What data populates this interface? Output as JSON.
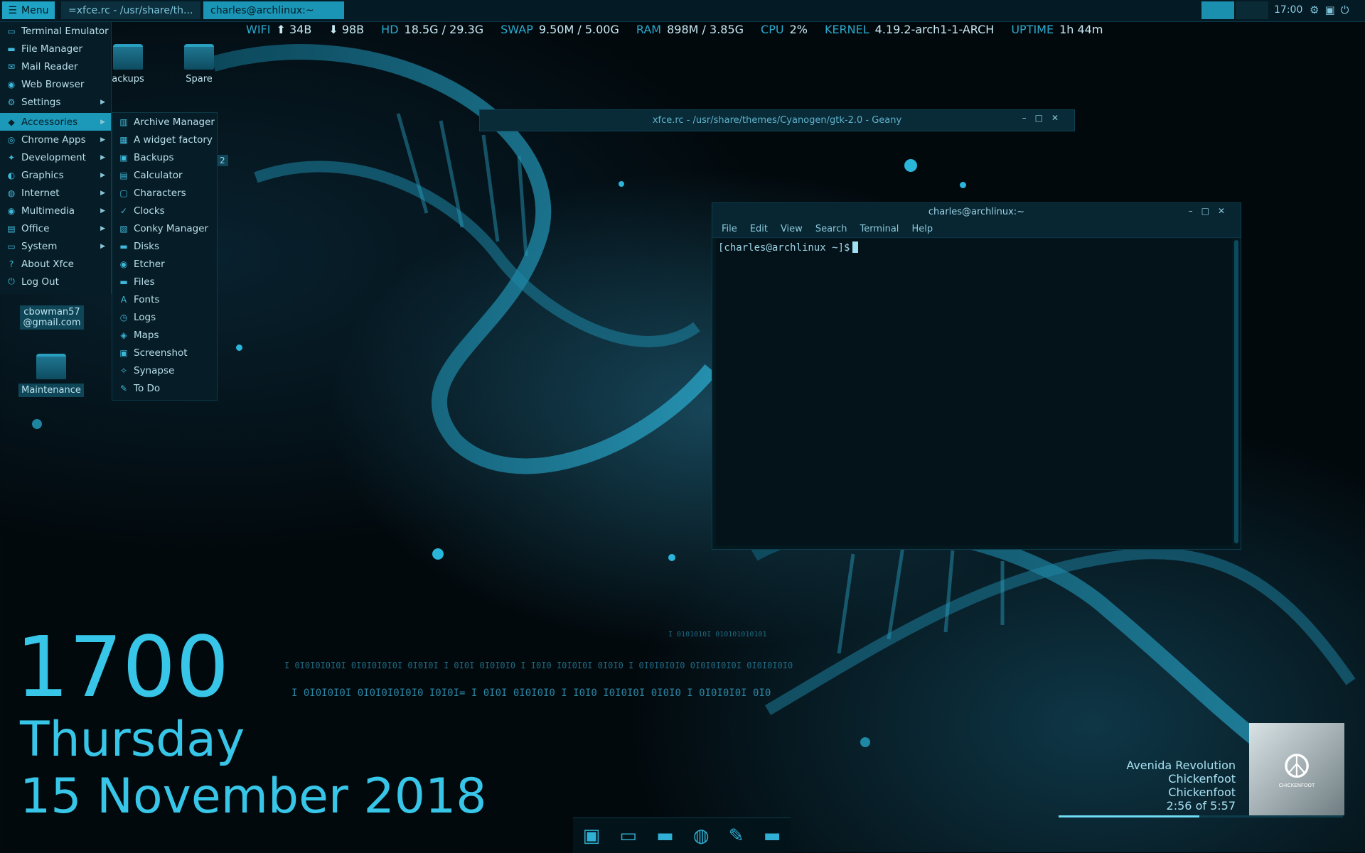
{
  "taskbar": {
    "menu_label": "Menu",
    "tasks": [
      {
        "label": "=xfce.rc - /usr/share/th..."
      },
      {
        "label": "charles@archlinux:~"
      }
    ],
    "clock": "17:00"
  },
  "conky": {
    "wifi_label": "WIFI",
    "wifi_up": "34B",
    "wifi_down": "98B",
    "hd_label": "HD",
    "hd_used": "18.5G",
    "hd_total": "/ 29.3G",
    "swap_label": "SWAP",
    "swap_used": "9.50M",
    "swap_total": "/ 5.00G",
    "ram_label": "RAM",
    "ram_used": "898M",
    "ram_total": "/ 3.85G",
    "cpu_label": "CPU",
    "cpu_val": "2%",
    "kernel_label": "KERNEL",
    "kernel_val": "4.19.2-arch1-1-ARCH",
    "uptime_label": "UPTIME",
    "uptime_val": "1h 44m"
  },
  "desktop_icons": {
    "backups": "ackups",
    "spare": "Spare",
    "email_line1": "cbowman57",
    "email_line2": "@gmail.com",
    "maintenance": "Maintenance",
    "badge": "2"
  },
  "app_menu": {
    "items": [
      {
        "label": "Terminal Emulator",
        "icon": "terminal-icon"
      },
      {
        "label": "File Manager",
        "icon": "folder-icon"
      },
      {
        "label": "Mail Reader",
        "icon": "mail-icon"
      },
      {
        "label": "Web Browser",
        "icon": "globe-icon"
      },
      {
        "label": "Settings",
        "icon": "settings-icon"
      },
      {
        "label": "Accessories",
        "icon": "accessories-icon"
      },
      {
        "label": "Chrome Apps",
        "icon": "chrome-icon"
      },
      {
        "label": "Development",
        "icon": "development-icon"
      },
      {
        "label": "Graphics",
        "icon": "graphics-icon"
      },
      {
        "label": "Internet",
        "icon": "internet-icon"
      },
      {
        "label": "Multimedia",
        "icon": "multimedia-icon"
      },
      {
        "label": "Office",
        "icon": "office-icon"
      },
      {
        "label": "System",
        "icon": "system-icon"
      },
      {
        "label": "About Xfce",
        "icon": "about-icon"
      },
      {
        "label": "Log Out",
        "icon": "logout-icon"
      }
    ],
    "submenu": [
      {
        "label": "Archive Manager"
      },
      {
        "label": "A widget factory"
      },
      {
        "label": "Backups"
      },
      {
        "label": "Calculator"
      },
      {
        "label": "Characters"
      },
      {
        "label": "Clocks"
      },
      {
        "label": "Conky Manager"
      },
      {
        "label": "Disks"
      },
      {
        "label": "Etcher"
      },
      {
        "label": "Files"
      },
      {
        "label": "Fonts"
      },
      {
        "label": "Logs"
      },
      {
        "label": "Maps"
      },
      {
        "label": "Screenshot"
      },
      {
        "label": "Synapse"
      },
      {
        "label": "To Do"
      }
    ]
  },
  "geany": {
    "title": "xfce.rc - /usr/share/themes/Cyanogen/gtk-2.0 - Geany"
  },
  "terminal": {
    "title": "charles@archlinux:~",
    "menu": [
      "File",
      "Edit",
      "View",
      "Search",
      "Terminal",
      "Help"
    ],
    "prompt": "[charles@archlinux ~]$"
  },
  "big_clock": {
    "time": "1700",
    "day": "Thursday",
    "date": "15 November 2018"
  },
  "music": {
    "title": "Avenida Revolution",
    "artist": "Chickenfoot",
    "album": "Chickenfoot",
    "position": "2:56 of 5:57",
    "progress_fraction": 0.494,
    "album_art_text": "CHICKENFOOT"
  },
  "colors": {
    "accent": "#1fa3c4",
    "panel_bg": "#041a24",
    "clock_text": "#38c6e8"
  }
}
